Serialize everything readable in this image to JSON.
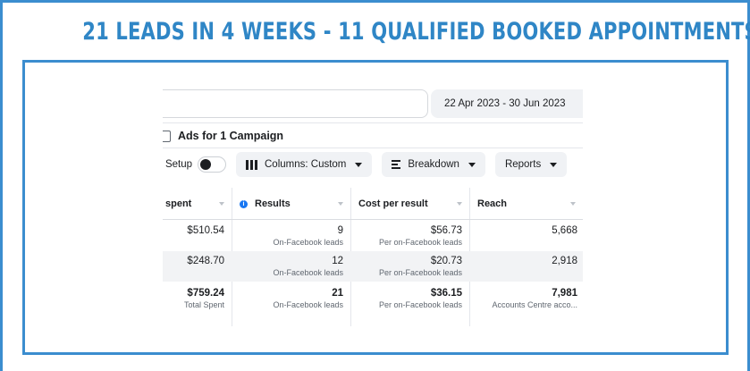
{
  "headline": "21 LEADS IN 4 WEEKS - 11 QUALIFIED BOOKED APPOINTMENTS",
  "colors": {
    "accent": "#2f86c6",
    "frame": "#3b8dcf",
    "fb_blue": "#1877f2"
  },
  "screenshot": {
    "date_range": "22 Apr 2023 - 30 Jun 2023",
    "campaign_title": "Ads for 1 Campaign",
    "toolbar": {
      "setup_label": "v Setup",
      "columns_label": "Columns: Custom",
      "breakdown_label": "Breakdown",
      "reports_label": "Reports"
    },
    "columns": [
      "spent",
      "Results",
      "Cost per result",
      "Reach"
    ],
    "rows": [
      {
        "spent": "$510.54",
        "results": "9",
        "results_sub": "On-Facebook leads",
        "cost": "$56.73",
        "cost_sub": "Per on-Facebook leads",
        "reach": "5,668"
      },
      {
        "spent": "$248.70",
        "results": "12",
        "results_sub": "On-Facebook leads",
        "cost": "$20.73",
        "cost_sub": "Per on-Facebook leads",
        "reach": "2,918"
      }
    ],
    "totals": {
      "spent": "$759.24",
      "spent_sub": "Total Spent",
      "results": "21",
      "results_sub": "On-Facebook leads",
      "cost": "$36.15",
      "cost_sub": "Per on-Facebook leads",
      "reach": "7,981",
      "reach_sub": "Accounts Centre acco..."
    }
  }
}
